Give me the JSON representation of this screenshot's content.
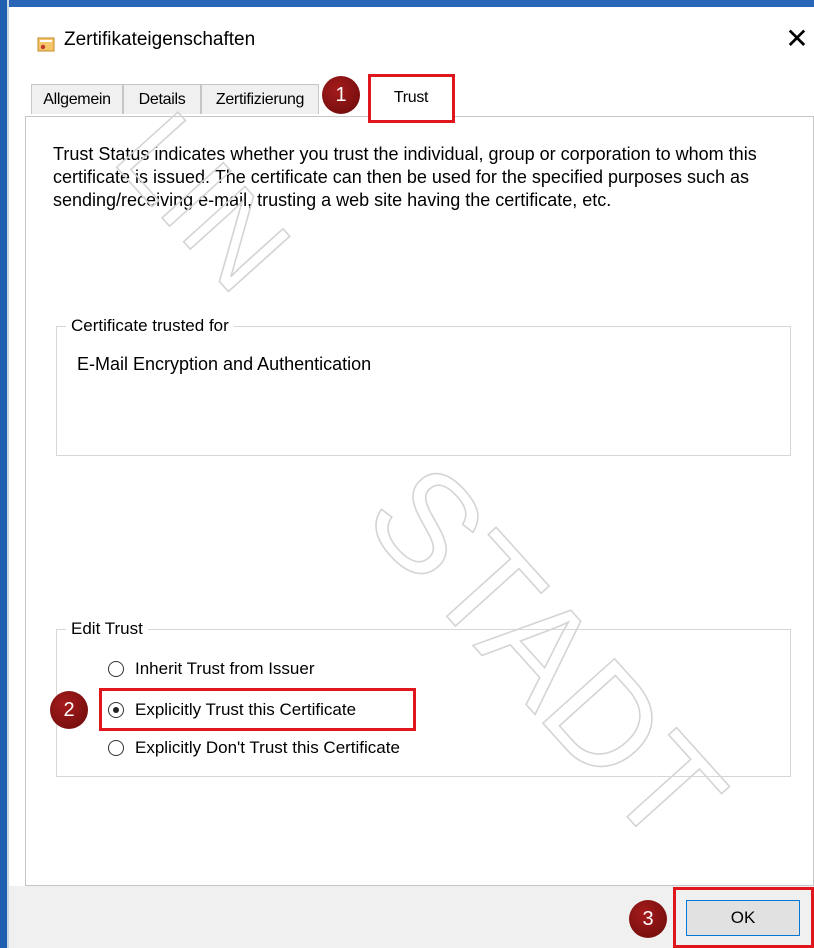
{
  "window": {
    "title": "Zertifikateigenschaften",
    "close_glyph": "✕",
    "icon": "certificate-icon"
  },
  "tabs": [
    {
      "label": "Allgemein",
      "active": false
    },
    {
      "label": "Details",
      "active": false
    },
    {
      "label": "Zertifizierung",
      "active": false
    },
    {
      "label": "Trust",
      "active": true
    }
  ],
  "trust_panel": {
    "description": "Trust Status indicates whether you trust the individual, group or corporation to whom this certificate is issued.  The certificate can then be used for the specified purposes such as sending/receiving e-mail, trusting a web site having the certificate, etc.",
    "trusted_for": {
      "legend": "Certificate trusted for",
      "items": [
        "E-Mail Encryption and Authentication"
      ]
    },
    "edit_trust": {
      "legend": "Edit Trust",
      "options": [
        {
          "label": "Inherit Trust from Issuer",
          "selected": false
        },
        {
          "label": "Explicitly Trust this Certificate",
          "selected": true
        },
        {
          "label": "Explicitly Don't Trust this Certificate",
          "selected": false
        }
      ]
    }
  },
  "footer": {
    "ok_label": "OK"
  },
  "annotations": {
    "step_1": "1",
    "step_2": "2",
    "step_3": "3",
    "highlight_color": "#e0161d",
    "marker_color": "#7a1010"
  },
  "watermark": {
    "text": "STADT",
    "partial_text": "LIN"
  }
}
